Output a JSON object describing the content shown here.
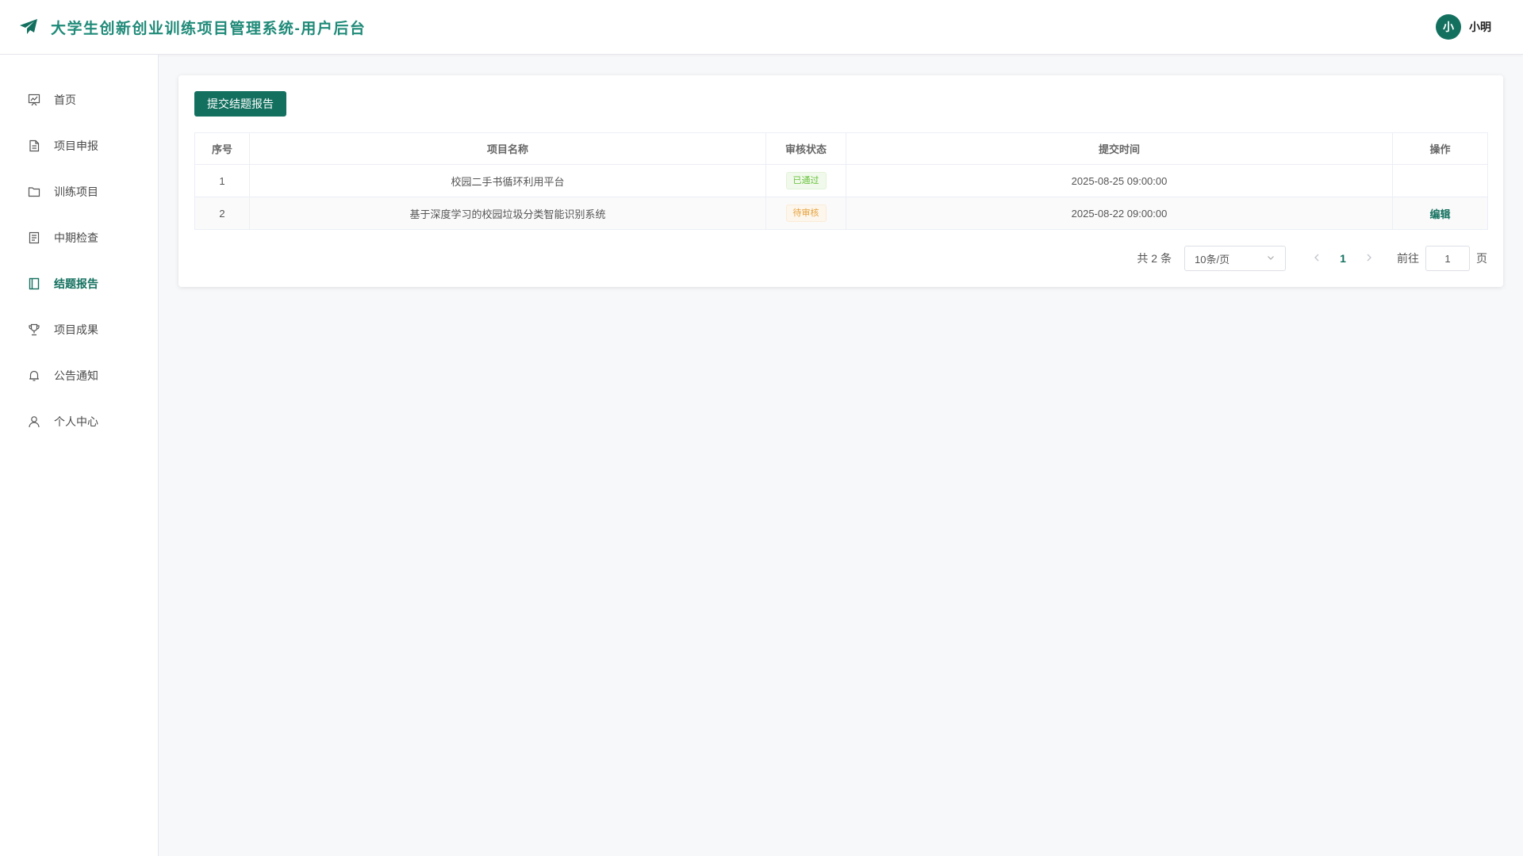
{
  "header": {
    "title": "大学生创新创业训练项目管理系统-用户后台",
    "user": {
      "avatar_text": "小",
      "name": "小明"
    }
  },
  "sidebar": {
    "items": [
      {
        "label": "首页",
        "icon": "chart-board-icon",
        "active": false
      },
      {
        "label": "项目申报",
        "icon": "document-icon",
        "active": false
      },
      {
        "label": "训练项目",
        "icon": "folder-icon",
        "active": false
      },
      {
        "label": "中期检查",
        "icon": "checklist-icon",
        "active": false
      },
      {
        "label": "结题报告",
        "icon": "notebook-icon",
        "active": true
      },
      {
        "label": "项目成果",
        "icon": "trophy-icon",
        "active": false
      },
      {
        "label": "公告通知",
        "icon": "bell-icon",
        "active": false
      },
      {
        "label": "个人中心",
        "icon": "user-icon",
        "active": false
      }
    ]
  },
  "main": {
    "submit_button": "提交结题报告",
    "table": {
      "headers": [
        "序号",
        "项目名称",
        "审核状态",
        "提交时间",
        "操作"
      ],
      "rows": [
        {
          "index": "1",
          "name": "校园二手书循环利用平台",
          "status": "已通过",
          "time": "2025-08-25 09:00:00",
          "action": ""
        },
        {
          "index": "2",
          "name": "基于深度学习的校园垃圾分类智能识别系统",
          "status": "待审核",
          "time": "2025-08-22 09:00:00",
          "action": "编辑"
        }
      ]
    },
    "pagination": {
      "total": "共 2 条",
      "page_size": "10条/页",
      "current_page": "1",
      "goto_label": "前往",
      "goto_value": "1",
      "page_unit": "页"
    }
  },
  "colors": {
    "primary": "#13705f",
    "title": "#1f8a78",
    "success": "#67c23a",
    "warning": "#e6a23c"
  }
}
